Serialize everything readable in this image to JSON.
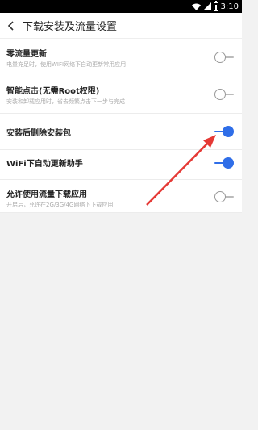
{
  "status_bar": {
    "time": "3:10"
  },
  "app_bar": {
    "title": "下载安装及流量设置"
  },
  "settings": [
    {
      "label": "零流量更新",
      "description": "电量充足时，使用WIFI网络下自动更新常用应用",
      "enabled": false
    },
    {
      "label": "智能点击(无需Root权限)",
      "description": "安装和卸载应用时，省去频繁点击下一步与完成",
      "enabled": false
    },
    {
      "label": "安装后删除安装包",
      "description": "",
      "enabled": true
    },
    {
      "label": "WiFi下自动更新助手",
      "description": "",
      "enabled": true
    },
    {
      "label": "允许使用流量下载应用",
      "description": "开启后，允许在2G/3G/4G网络下下载应用",
      "enabled": false
    }
  ],
  "colors": {
    "accent": "#2f6ee8",
    "annotation_arrow": "#e53935"
  }
}
